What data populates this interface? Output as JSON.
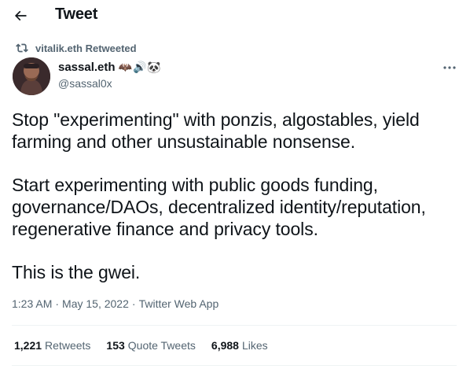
{
  "header": {
    "title": "Tweet",
    "back_icon": "arrow-left-icon"
  },
  "retweet": {
    "icon": "retweet-icon",
    "text": "vitalik.eth Retweeted"
  },
  "author": {
    "display_name": "sassal.eth",
    "name_emojis": [
      "🦇",
      "🔊",
      "🐼"
    ],
    "handle": "@sassal0x"
  },
  "tweet": {
    "paragraphs": [
      [
        "Stop \"experimenting\" with ponzis, algostables, yield",
        "farming and other unsustainable nonsense."
      ],
      [
        "Start experimenting with public goods funding,",
        "governance/DAOs, decentralized identity/reputation,",
        "regenerative finance and privacy tools."
      ],
      [
        "This is the gwei."
      ]
    ]
  },
  "meta": {
    "time": "1:23 AM",
    "sep1": "·",
    "date": "May 15, 2022",
    "sep2": "·",
    "source": "Twitter Web App"
  },
  "stats": {
    "retweets_count": "1,221",
    "retweets_label": "Retweets",
    "quotes_count": "153",
    "quotes_label": "Quote Tweets",
    "likes_count": "6,988",
    "likes_label": "Likes"
  },
  "colors": {
    "text_primary": "#0f1419",
    "text_secondary": "#536471",
    "divider": "#eff3f4"
  }
}
